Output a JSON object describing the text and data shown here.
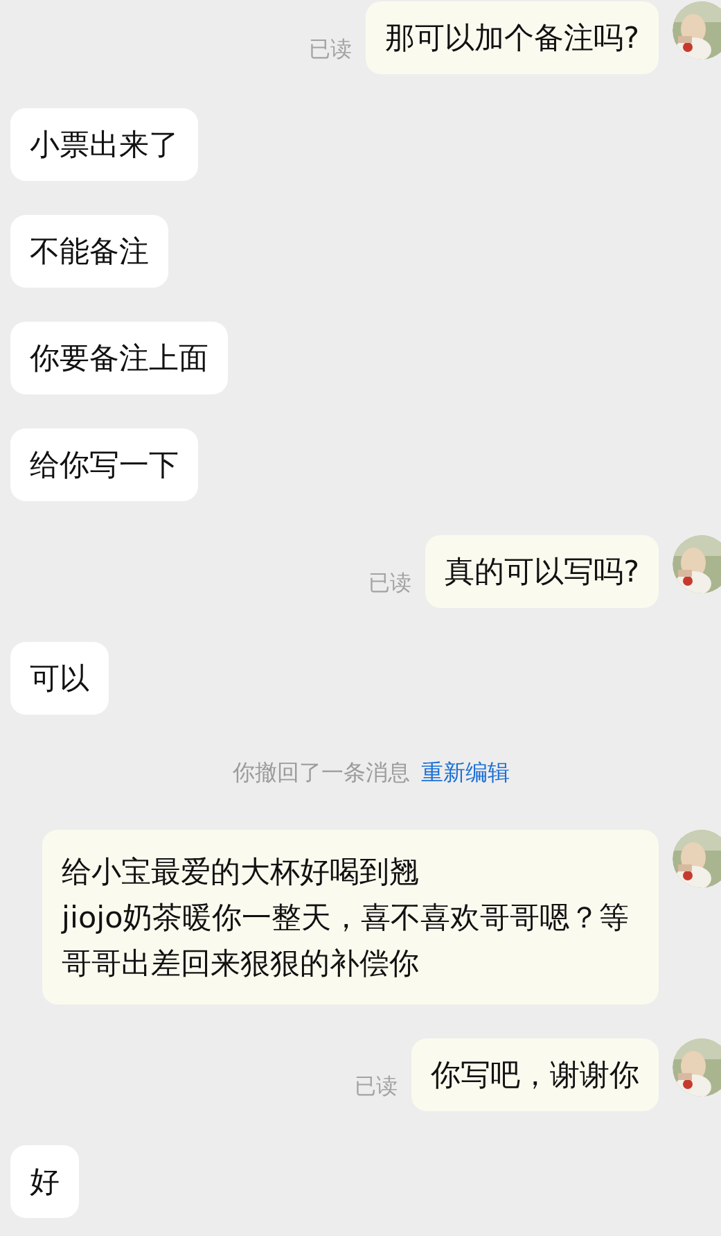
{
  "messages": [
    {
      "kind": "outgoing",
      "text": "那可以加个备注吗?",
      "status": "已读"
    },
    {
      "kind": "incoming",
      "text": "小票出来了"
    },
    {
      "kind": "incoming",
      "text": "不能备注"
    },
    {
      "kind": "incoming",
      "text": "你要备注上面"
    },
    {
      "kind": "incoming",
      "text": "给你写一下"
    },
    {
      "kind": "outgoing",
      "text": "真的可以写吗?",
      "status": "已读"
    },
    {
      "kind": "incoming",
      "text": "可以"
    },
    {
      "kind": "system",
      "text": "你撤回了一条消息",
      "link": "重新编辑"
    },
    {
      "kind": "outgoing",
      "text": "给小宝最爱的大杯好喝到翘\njiojo奶茶暖你一整天，喜不喜欢哥哥嗯？等哥哥出差回来狠狠的补偿你"
    },
    {
      "kind": "outgoing",
      "text": "你写吧，谢谢你",
      "status": "已读"
    },
    {
      "kind": "incoming",
      "text": "好"
    }
  ]
}
